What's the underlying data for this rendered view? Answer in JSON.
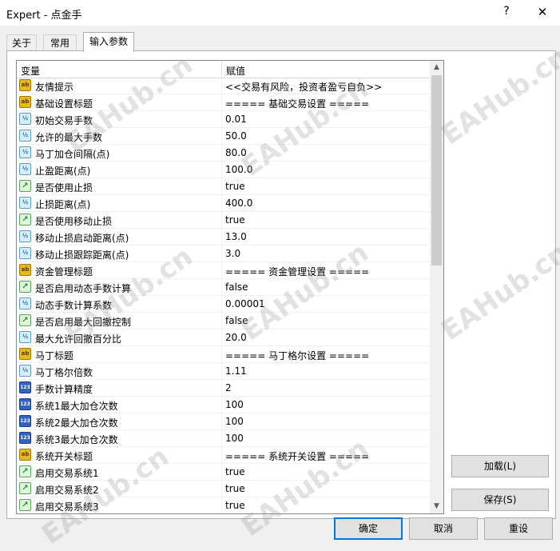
{
  "window": {
    "title": "Expert - 点金手",
    "help_label": "?",
    "close_label": "✕"
  },
  "tabs": [
    {
      "label": "关于"
    },
    {
      "label": "常用"
    },
    {
      "label": "输入参数"
    }
  ],
  "grid": {
    "col_name": "变量",
    "col_value": "赋值",
    "rows": [
      {
        "icon": "ab",
        "name": "友情提示",
        "value": "<<交易有风险，投资者盈亏自负>>"
      },
      {
        "icon": "ab",
        "name": "基础设置标题",
        "value": "===== 基础交易设置 ====="
      },
      {
        "icon": "double",
        "name": "初始交易手数",
        "value": "0.01"
      },
      {
        "icon": "double",
        "name": "允许的最大手数",
        "value": "50.0"
      },
      {
        "icon": "double",
        "name": "马丁加仓间隔(点)",
        "value": "80.0"
      },
      {
        "icon": "double",
        "name": "止盈距离(点)",
        "value": "100.0"
      },
      {
        "icon": "bool",
        "name": "是否使用止损",
        "value": "true"
      },
      {
        "icon": "double",
        "name": "止损距离(点)",
        "value": "400.0"
      },
      {
        "icon": "bool",
        "name": "是否使用移动止损",
        "value": "true"
      },
      {
        "icon": "double",
        "name": "移动止损启动距离(点)",
        "value": "13.0"
      },
      {
        "icon": "double",
        "name": "移动止损跟踪距离(点)",
        "value": "3.0"
      },
      {
        "icon": "ab",
        "name": "资金管理标题",
        "value": "===== 资金管理设置 ====="
      },
      {
        "icon": "bool",
        "name": "是否启用动态手数计算",
        "value": "false"
      },
      {
        "icon": "double",
        "name": "动态手数计算系数",
        "value": "0.00001"
      },
      {
        "icon": "bool",
        "name": "是否启用最大回撤控制",
        "value": "false"
      },
      {
        "icon": "double",
        "name": "最大允许回撤百分比",
        "value": "20.0"
      },
      {
        "icon": "ab",
        "name": "马丁标题",
        "value": "===== 马丁格尔设置 ====="
      },
      {
        "icon": "double",
        "name": "马丁格尔倍数",
        "value": "1.11"
      },
      {
        "icon": "int",
        "name": "手数计算精度",
        "value": "2"
      },
      {
        "icon": "int",
        "name": "系统1最大加仓次数",
        "value": "100"
      },
      {
        "icon": "int",
        "name": "系统2最大加仓次数",
        "value": "100"
      },
      {
        "icon": "int",
        "name": "系统3最大加仓次数",
        "value": "100"
      },
      {
        "icon": "ab",
        "name": "系统开关标题",
        "value": "===== 系统开关设置 ====="
      },
      {
        "icon": "bool",
        "name": "启用交易系统1",
        "value": "true"
      },
      {
        "icon": "bool",
        "name": "启用交易系统2",
        "value": "true"
      },
      {
        "icon": "bool",
        "name": "启用交易系统3",
        "value": "true"
      }
    ]
  },
  "buttons": {
    "load": "加载(L)",
    "save": "保存(S)",
    "ok": "确定",
    "cancel": "取消",
    "reset": "重设"
  },
  "watermark": "EAHub.cn",
  "icon_glyphs": {
    "ab": "ab",
    "double": "½",
    "bool": "↗",
    "int": "123"
  }
}
